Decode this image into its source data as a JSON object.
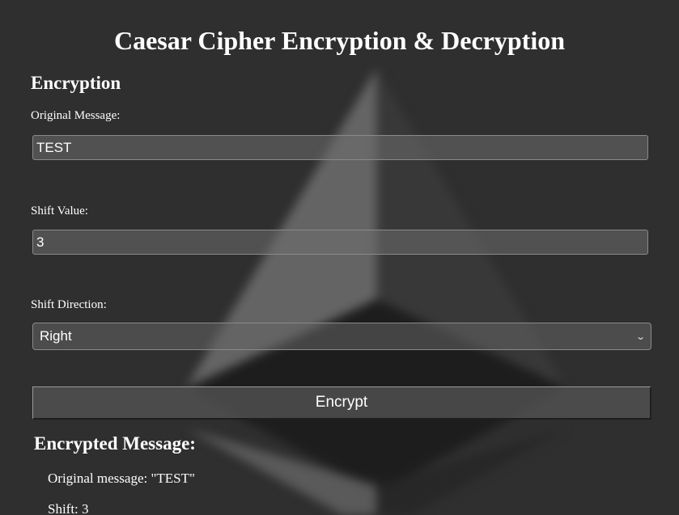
{
  "page": {
    "title": "Caesar Cipher Encryption & Decryption"
  },
  "encryption": {
    "heading": "Encryption",
    "original_message_label": "Original Message:",
    "original_message_value": "TEST",
    "shift_value_label": "Shift Value:",
    "shift_value": "3",
    "shift_direction_label": "Shift Direction:",
    "shift_direction_selected": "Right",
    "encrypt_button_label": "Encrypt"
  },
  "result": {
    "heading": "Encrypted Message:",
    "original_line": "Original message: \"TEST\"",
    "shift_line": "Shift: 3"
  },
  "icons": {
    "select_chevron": "chevron-down-icon"
  },
  "colors": {
    "background": "#2f2f2f",
    "text": "#ffffff"
  }
}
